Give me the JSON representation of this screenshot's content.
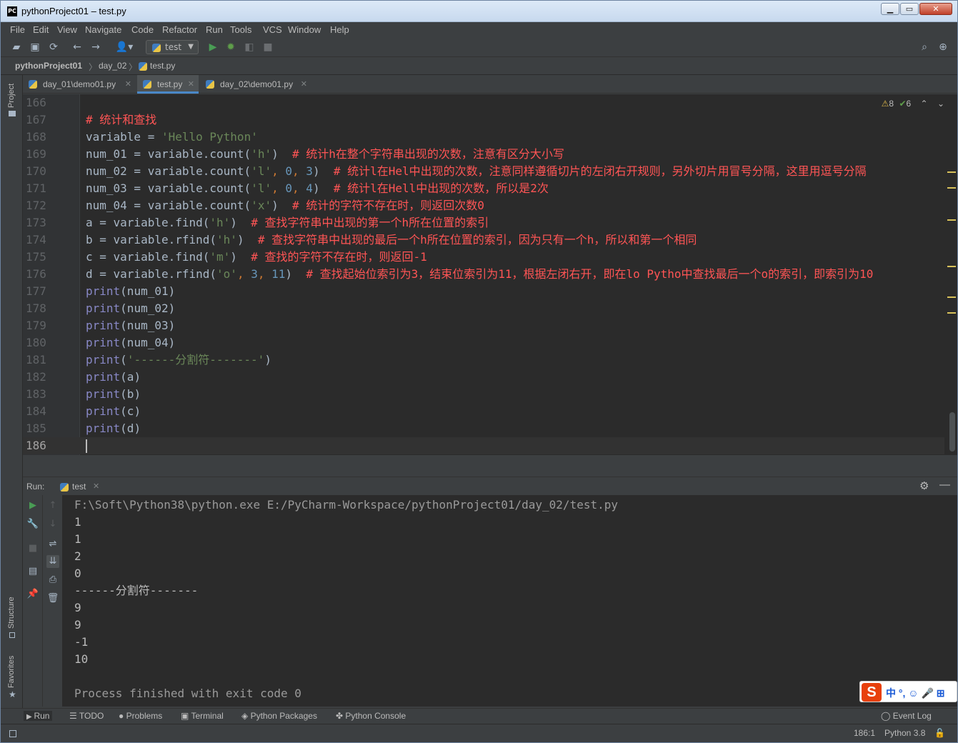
{
  "window": {
    "title": "pythonProject01 – test.py",
    "app_icon": "PC"
  },
  "menu": [
    "File",
    "Edit",
    "View",
    "Navigate",
    "Code",
    "Refactor",
    "Run",
    "Tools",
    "VCS",
    "Window",
    "Help"
  ],
  "toolbar": {
    "run_config": "test"
  },
  "breadcrumb": [
    "pythonProject01",
    "day_02",
    "test.py"
  ],
  "left_tools": {
    "project": "Project",
    "structure": "Structure",
    "favorites": "Favorites"
  },
  "tabs": [
    {
      "label": "day_01\\demo01.py"
    },
    {
      "label": "test.py",
      "active": true
    },
    {
      "label": "day_02\\demo01.py"
    }
  ],
  "inspections": {
    "warnings": "8",
    "weak": "6"
  },
  "editor": {
    "lines": [
      {
        "n": "166",
        "text": ""
      },
      {
        "n": "167",
        "text": "# 统计和查找"
      },
      {
        "n": "168",
        "text": "variable = 'Hello Python'"
      },
      {
        "n": "169",
        "text": "num_01 = variable.count('h')  # 统计h在整个字符串出现的次数，注意有区分大小写"
      },
      {
        "n": "170",
        "text": "num_02 = variable.count('l', 0, 3)  # 统计l在Hel中出现的次数，注意同样遵循切片的左闭右开规则，另外切片用冒号分隔，这里用逗号分隔"
      },
      {
        "n": "171",
        "text": "num_03 = variable.count('l', 0, 4)  # 统计l在Hell中出现的次数，所以是2次"
      },
      {
        "n": "172",
        "text": "num_04 = variable.count('x')  # 统计的字符不存在时，则返回次数0"
      },
      {
        "n": "173",
        "text": "a = variable.find('h')  # 查找字符串中出现的第一个h所在位置的索引"
      },
      {
        "n": "174",
        "text": "b = variable.rfind('h')  # 查找字符串中出现的最后一个h所在位置的索引，因为只有一个h，所以和第一个相同"
      },
      {
        "n": "175",
        "text": "c = variable.find('m')  # 查找的字符不存在时，则返回-1"
      },
      {
        "n": "176",
        "text": "d = variable.rfind('o', 3, 11)  # 查找起始位索引为3，结束位索引为11，根据左闭右开，即在lo Pytho中查找最后一个o的索引，即索引为10"
      },
      {
        "n": "177",
        "text": "print(num_01)"
      },
      {
        "n": "178",
        "text": "print(num_02)"
      },
      {
        "n": "179",
        "text": "print(num_03)"
      },
      {
        "n": "180",
        "text": "print(num_04)"
      },
      {
        "n": "181",
        "text": "print('------分割符-------')"
      },
      {
        "n": "182",
        "text": "print(a)"
      },
      {
        "n": "183",
        "text": "print(b)"
      },
      {
        "n": "184",
        "text": "print(c)"
      },
      {
        "n": "185",
        "text": "print(d)"
      },
      {
        "n": "186",
        "text": ""
      }
    ]
  },
  "run": {
    "label": "Run:",
    "tab": "test",
    "output": [
      "F:\\Soft\\Python38\\python.exe E:/PyCharm-Workspace/pythonProject01/day_02/test.py",
      "1",
      "1",
      "2",
      "0",
      "------分割符-------",
      "9",
      "9",
      "-1",
      "10",
      "",
      "Process finished with exit code 0"
    ]
  },
  "ime": {
    "logo": "S",
    "text": "中 °, ☺ 🎤 ⊞"
  },
  "bottom_tabs": [
    "Run",
    "TODO",
    "Problems",
    "Terminal",
    "Python Packages",
    "Python Console"
  ],
  "event_log": "Event Log",
  "status": {
    "position": "186:1",
    "interpreter": "Python 3.8"
  }
}
